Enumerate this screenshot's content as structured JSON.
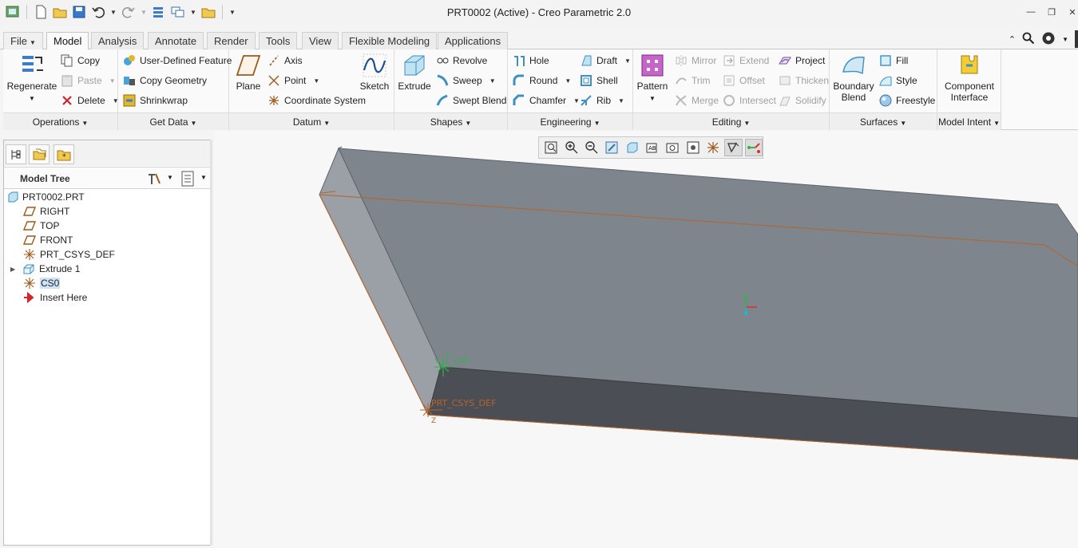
{
  "window": {
    "title": "PRT0002 (Active) - Creo Parametric 2.0"
  },
  "ribbon_tabs": [
    "File",
    "Model",
    "Analysis",
    "Annotate",
    "Render",
    "Tools",
    "View",
    "Flexible Modeling",
    "Applications"
  ],
  "active_tab": "Model",
  "groups": {
    "operations": {
      "label": "Operations",
      "regenerate": "Regenerate",
      "copy": "Copy",
      "paste": "Paste",
      "delete": "Delete"
    },
    "get_data": {
      "label": "Get Data",
      "user_defined_feature": "User-Defined Feature",
      "copy_geometry": "Copy Geometry",
      "shrinkwrap": "Shrinkwrap"
    },
    "datum": {
      "label": "Datum",
      "plane": "Plane",
      "axis": "Axis",
      "point": "Point",
      "coordinate_system": "Coordinate System",
      "sketch": "Sketch"
    },
    "shapes": {
      "label": "Shapes",
      "extrude": "Extrude",
      "revolve": "Revolve",
      "sweep": "Sweep",
      "swept_blend": "Swept Blend"
    },
    "engineering": {
      "label": "Engineering",
      "hole": "Hole",
      "round": "Round",
      "chamfer": "Chamfer",
      "draft": "Draft",
      "shell": "Shell",
      "rib": "Rib"
    },
    "editing": {
      "label": "Editing",
      "pattern": "Pattern",
      "mirror": "Mirror",
      "trim": "Trim",
      "merge": "Merge",
      "extend": "Extend",
      "offset": "Offset",
      "intersect": "Intersect",
      "project": "Project",
      "thicken": "Thicken",
      "solidify": "Solidify"
    },
    "surfaces": {
      "label": "Surfaces",
      "boundary_blend_line1": "Boundary",
      "boundary_blend_line2": "Blend",
      "fill": "Fill",
      "style": "Style",
      "freestyle": "Freestyle"
    },
    "model_intent": {
      "label": "Model Intent",
      "component_interface_line1": "Component",
      "component_interface_line2": "Interface"
    }
  },
  "model_tree": {
    "title": "Model Tree",
    "items": [
      {
        "label": "PRT0002.PRT"
      },
      {
        "label": "RIGHT"
      },
      {
        "label": "TOP"
      },
      {
        "label": "FRONT"
      },
      {
        "label": "PRT_CSYS_DEF"
      },
      {
        "label": "Extrude 1"
      },
      {
        "label": "CS0",
        "selected": true
      },
      {
        "label": "Insert Here"
      }
    ]
  },
  "viewport": {
    "csys_label": "PRT_CSYS_DEF",
    "cs0_label": "CS0",
    "axis_y": "Y",
    "axis_z": "Z",
    "colors": {
      "top_face": "#7f858c",
      "side_face": "#4b4f55",
      "edge": "#b5642a",
      "background": "#f7f7f7"
    }
  },
  "colors": {
    "accent": "#1b6ec2",
    "selection": "#cfe3f7"
  }
}
